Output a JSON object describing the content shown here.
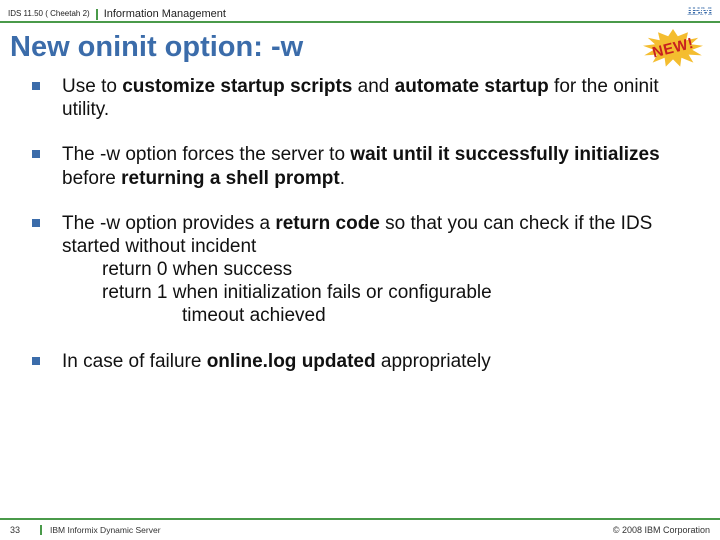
{
  "header": {
    "product": "IDS 11.50 ( Cheetah 2)",
    "group": "Information Management",
    "logo_label": "IBM"
  },
  "title": "New oninit option: -w",
  "badge": "NEW!",
  "bullets": [
    {
      "segments": [
        {
          "t": "Use to ",
          "b": false
        },
        {
          "t": "customize startup scripts",
          "b": true
        },
        {
          "t": " and ",
          "b": false
        },
        {
          "t": "automate startup",
          "b": true
        },
        {
          "t": " for the oninit utility.",
          "b": false
        }
      ]
    },
    {
      "segments": [
        {
          "t": "The -w option forces the server to ",
          "b": false
        },
        {
          "t": "wait until it successfully initializes",
          "b": true
        },
        {
          "t": " before ",
          "b": false
        },
        {
          "t": "returning a shell prompt",
          "b": true
        },
        {
          "t": ".",
          "b": false
        }
      ]
    },
    {
      "segments": [
        {
          "t": "The -w option provides a ",
          "b": false
        },
        {
          "t": "return code",
          "b": true
        },
        {
          "t": " so that you can check if the IDS started without incident",
          "b": false
        }
      ],
      "sub": [
        {
          "indent": 1,
          "t": "return 0   when success"
        },
        {
          "indent": 1,
          "t": "return 1   when initialization fails or configurable"
        },
        {
          "indent": 2,
          "t": "timeout achieved"
        }
      ]
    },
    {
      "segments": [
        {
          "t": "In case of failure ",
          "b": false
        },
        {
          "t": "online.log updated",
          "b": true
        },
        {
          "t": " appropriately",
          "b": false
        }
      ]
    }
  ],
  "footer": {
    "page": "33",
    "product_line": "IBM Informix Dynamic Server",
    "copyright": "© 2008 IBM Corporation"
  }
}
